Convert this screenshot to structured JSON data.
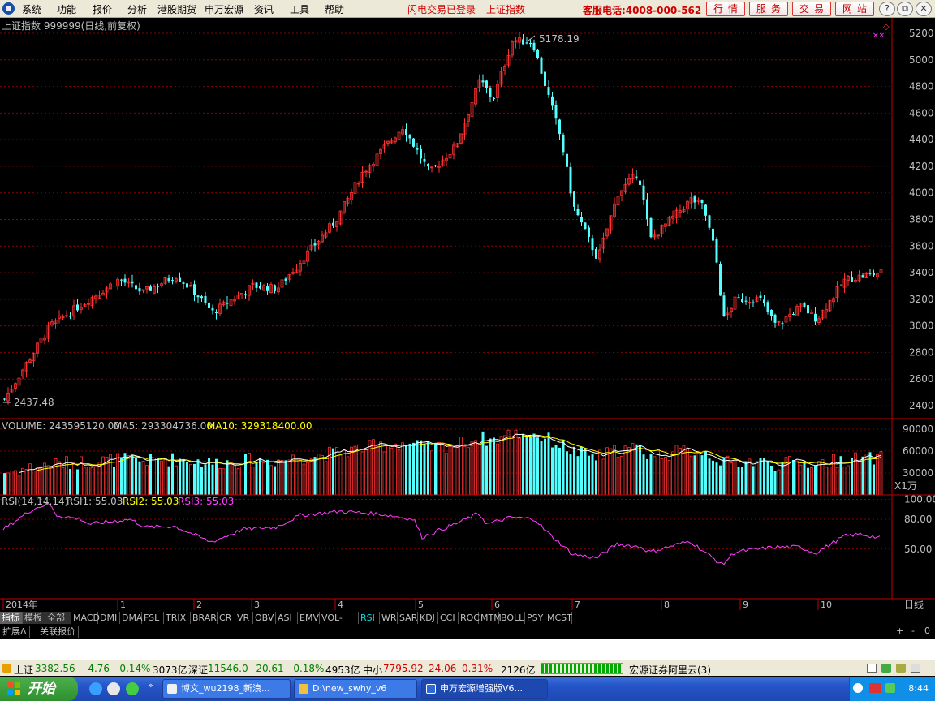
{
  "menubar": {
    "items": [
      "系统",
      "功能",
      "报价",
      "分析",
      "港股期货",
      "申万宏源",
      "资讯",
      "工具",
      "帮助"
    ],
    "status1": "闪电交易已登录",
    "status2": "上证指数",
    "hotline": "客服电话:4008-000-562",
    "buttons": [
      "行情",
      "服务",
      "交易",
      "网站"
    ]
  },
  "chart_data": [
    {
      "type": "candlestick",
      "title": "上证指数 999999(日线,前复权)",
      "y_ticks": [
        5200,
        5000,
        4800,
        4600,
        4400,
        4200,
        4000,
        3800,
        3600,
        3400,
        3200,
        3000,
        2800,
        2600,
        2400
      ],
      "high_label": "5178.19",
      "low_label": "2437.48",
      "colors": {
        "up": "#ff3232",
        "down": "#54ffff",
        "grid": "#8b0000"
      }
    },
    {
      "type": "bar",
      "title": "VOLUME: 243595120.00",
      "ma5_label": "MA5: 293304736.00",
      "ma10_label": "MA10: 329318400.00",
      "y_ticks": [
        90000,
        60000,
        30000
      ],
      "unit": "X1万"
    },
    {
      "type": "line",
      "title": "RSI(14,14,14)",
      "rsi1_label": "RSI1: 55.03",
      "rsi2_label": "RSI2: 55.03",
      "rsi3_label": "RSI3: 55.03",
      "y_ticks": [
        "100.00",
        "80.00",
        "50.00"
      ]
    }
  ],
  "x_axis": {
    "labels": [
      "2014年",
      "1",
      "2",
      "3",
      "4",
      "5",
      "6",
      "7",
      "8",
      "9",
      "10"
    ],
    "period": "日线"
  },
  "indicator_tabs": [
    "指标",
    "模板",
    "全部",
    "MACD",
    "DMI",
    "DMA",
    "FSL",
    "TRIX",
    "BRAR",
    "CR",
    "VR",
    "OBV",
    "ASI",
    "EMV",
    "VOL-TDX",
    "RSI",
    "WR",
    "SAR",
    "KDJ",
    "CCI",
    "ROC",
    "MTM",
    "BOLL",
    "PSY",
    "MCST"
  ],
  "active_indicator": "RSI",
  "ext_tabs": [
    "扩展Λ",
    "关联报价"
  ],
  "quote_bar": {
    "sh_name": "上证",
    "sh_val": "3382.56",
    "sh_chg": "-4.76",
    "sh_pct": "-0.14%",
    "sh_amt": "3073亿",
    "sz_name": "深证",
    "sz_val": "11546.0",
    "sz_chg": "-20.61",
    "sz_pct": "-0.18%",
    "sz_amt": "4953亿",
    "zx_name": "中小",
    "zx_val": "7795.92",
    "zx_chg": "24.06",
    "zx_pct": "0.31%",
    "zx_amt": "2126亿",
    "server": "宏源证券阿里云(3)"
  },
  "taskbar": {
    "start": "开始",
    "tasks": [
      "博文_wu2198_新浪...",
      "D:\\new_swhy_v6",
      "申万宏源增强版V6..."
    ],
    "clock": "8:44"
  }
}
